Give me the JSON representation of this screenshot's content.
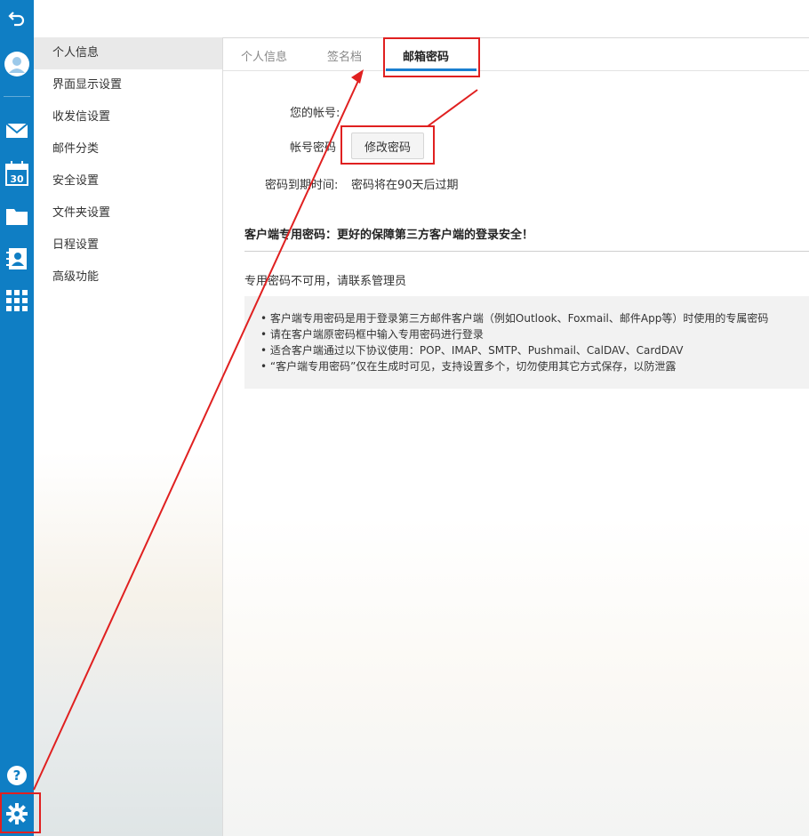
{
  "rail": {
    "icons": [
      "back-arrow-icon",
      "avatar-icon",
      "mail-icon",
      "calendar-icon",
      "folder-icon",
      "contacts-icon",
      "apps-grid-icon",
      "help-icon",
      "gear-icon"
    ],
    "calendar_day": "30",
    "help_glyph": "?"
  },
  "nav": {
    "items": [
      {
        "label": "个人信息",
        "active": true
      },
      {
        "label": "界面显示设置"
      },
      {
        "label": "收发信设置"
      },
      {
        "label": "邮件分类"
      },
      {
        "label": "安全设置"
      },
      {
        "label": "文件夹设置"
      },
      {
        "label": "日程设置"
      },
      {
        "label": "高级功能"
      }
    ]
  },
  "tabs": [
    {
      "label": "个人信息"
    },
    {
      "label": "签名档"
    },
    {
      "label": "邮箱密码",
      "active": true
    }
  ],
  "account": {
    "account_label": "您的帐号:",
    "password_label": "帐号密码",
    "change_button": "修改密码",
    "expiry_label": "密码到期时间:",
    "expiry_value": "密码将在90天后过期"
  },
  "client_password": {
    "title": "客户端专用密码：更好的保障第三方客户端的登录安全！",
    "unavailable": "专用密码不可用，请联系管理员",
    "tips": [
      "客户端专用密码是用于登录第三方邮件客户端（例如Outlook、Foxmail、邮件App等）时使用的专属密码",
      "请在客户端原密码框中输入专用密码进行登录",
      "适合客户端通过以下协议使用：POP、IMAP、SMTP、Pushmail、CalDAV、CardDAV",
      "“客户端专用密码”仅在生成时可见，支持设置多个，切勿使用其它方式保存，以防泄露"
    ]
  },
  "colors": {
    "rail": "#0f7ec4",
    "tab_underline": "#1a7fd0",
    "annotation": "#e02020"
  }
}
